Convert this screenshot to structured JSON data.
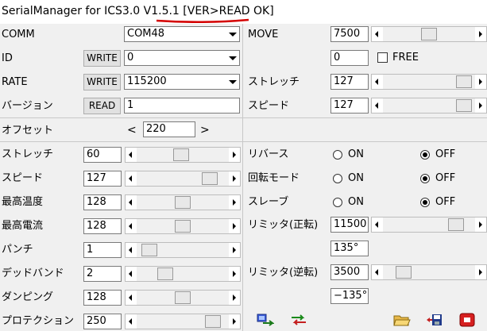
{
  "window": {
    "title": "SerialManager for ICS3.0 V1.5.1 [VER>READ OK]"
  },
  "colors": {
    "annotation": "#d40000",
    "radio_selected": "#000000"
  },
  "left": {
    "comm": {
      "label": "COMM",
      "value": "COM48"
    },
    "id": {
      "label": "ID",
      "button": "WRITE",
      "value": "0"
    },
    "rate": {
      "label": "RATE",
      "button": "WRITE",
      "value": "115200"
    },
    "version": {
      "label": "バージョン",
      "button": "READ",
      "value": "1"
    },
    "offset": {
      "label": "オフセット",
      "prev": "<",
      "value": "220",
      "next": ">"
    },
    "params": [
      {
        "label": "ストレッチ",
        "value": "60"
      },
      {
        "label": "スピード",
        "value": "127"
      },
      {
        "label": "最高温度",
        "value": "128"
      },
      {
        "label": "最高電流",
        "value": "128"
      },
      {
        "label": "パンチ",
        "value": "1"
      },
      {
        "label": "デッドバンド",
        "value": "2"
      },
      {
        "label": "ダンピング",
        "value": "128"
      },
      {
        "label": "プロテクション",
        "value": "250"
      }
    ]
  },
  "right": {
    "move": {
      "label": "MOVE",
      "value": "7500"
    },
    "free": {
      "value": "0",
      "label": "FREE"
    },
    "stretch": {
      "label": "ストレッチ",
      "value": "127"
    },
    "speed": {
      "label": "スピード",
      "value": "127"
    },
    "options": [
      {
        "label": "リバース",
        "on": "ON",
        "off": "OFF",
        "selected": "OFF"
      },
      {
        "label": "回転モード",
        "on": "ON",
        "off": "OFF",
        "selected": "OFF"
      },
      {
        "label": "スレーブ",
        "on": "ON",
        "off": "OFF",
        "selected": "OFF"
      }
    ],
    "limit_fwd": {
      "label": "リミッタ(正転)",
      "value": "11500",
      "angle": "135°"
    },
    "limit_rev": {
      "label": "リミッタ(逆転)",
      "value": "3500",
      "angle": "−135°"
    }
  },
  "toolbar": {
    "icons": [
      "connect-icon",
      "transfer-icon",
      "open-folder-icon",
      "save-icon",
      "stop-icon"
    ]
  }
}
